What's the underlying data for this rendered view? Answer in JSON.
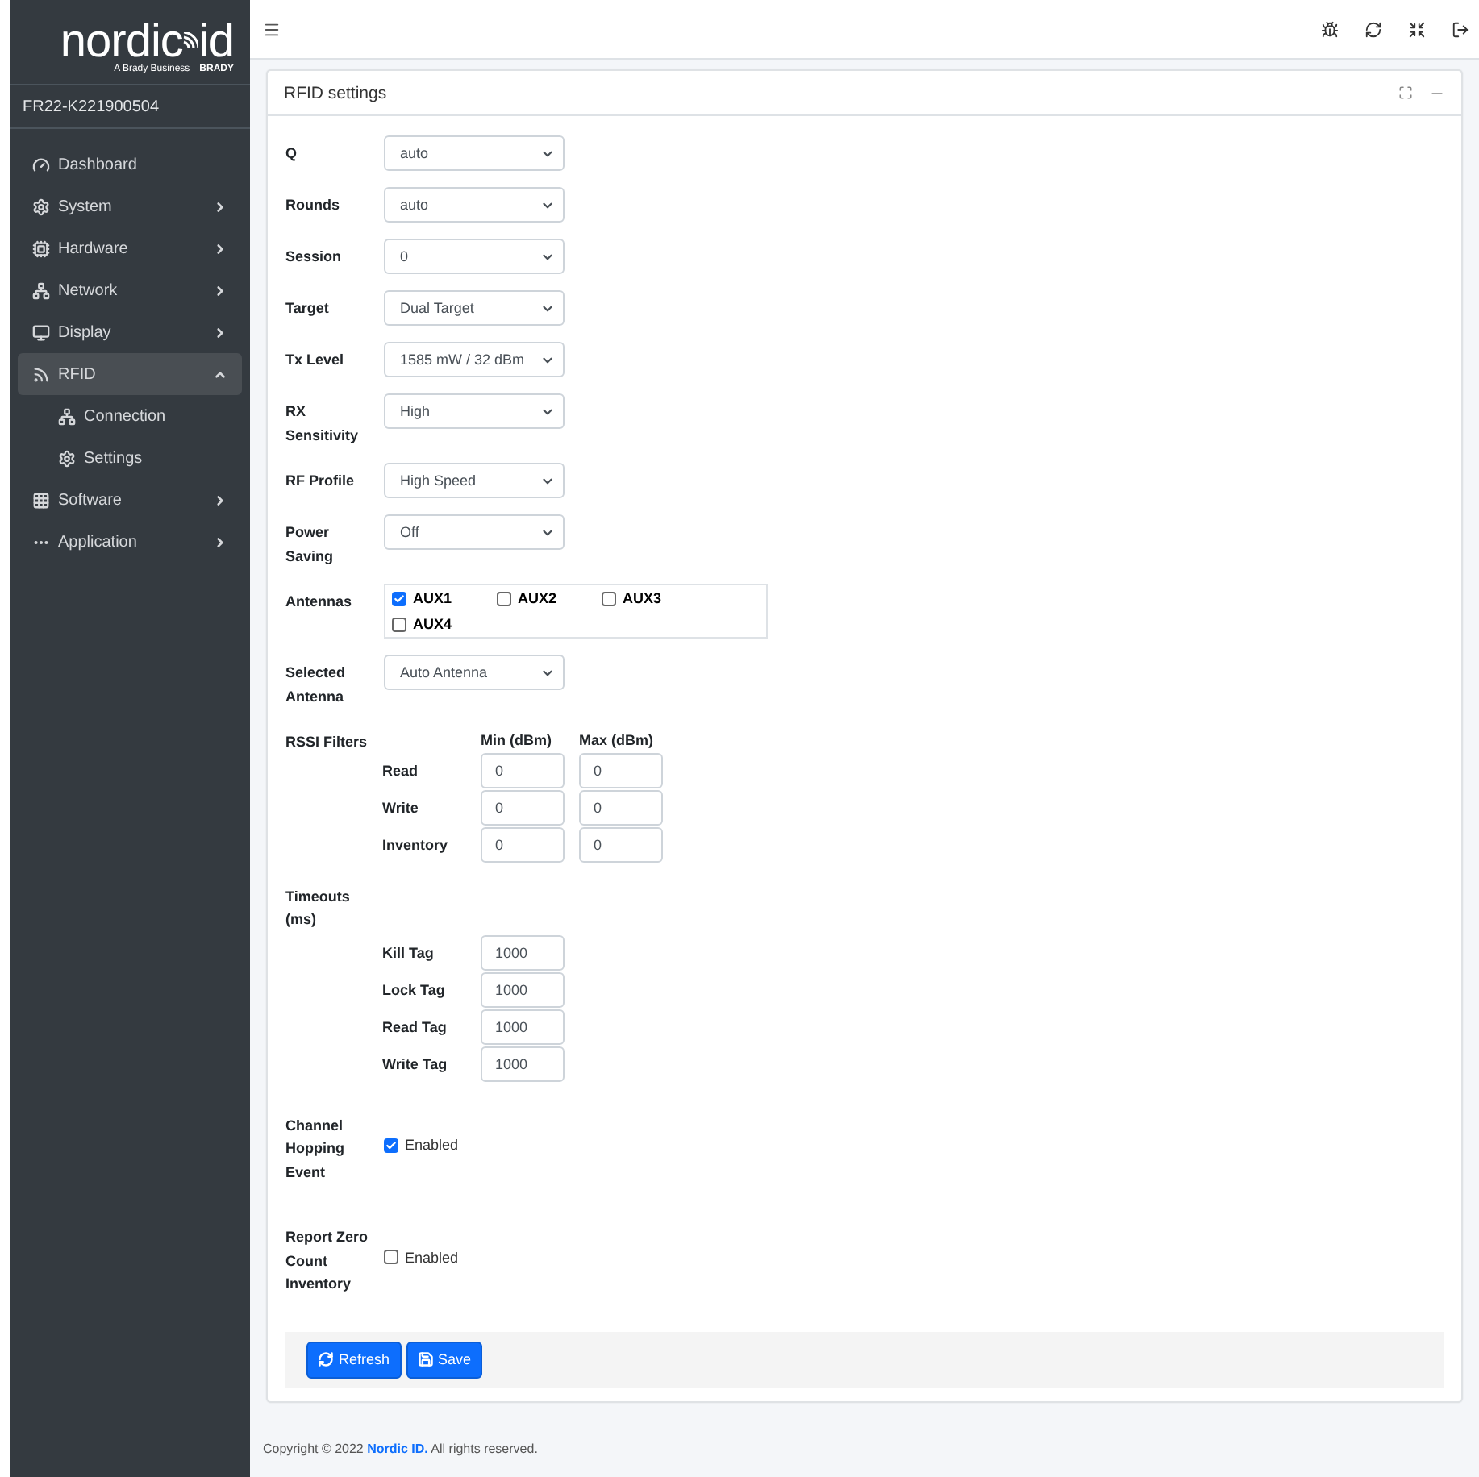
{
  "logo": {
    "name_left": "nordic",
    "name_right": "id",
    "tagline": "A Brady Business",
    "brand": "BRADY"
  },
  "device": "FR22-K221900504",
  "nav": [
    {
      "label": "Dashboard",
      "expandable": false,
      "expanded": false,
      "selected": false
    },
    {
      "label": "System",
      "expandable": true,
      "expanded": false,
      "selected": false
    },
    {
      "label": "Hardware",
      "expandable": true,
      "expanded": false,
      "selected": false
    },
    {
      "label": "Network",
      "expandable": true,
      "expanded": false,
      "selected": false
    },
    {
      "label": "Display",
      "expandable": true,
      "expanded": false,
      "selected": false
    },
    {
      "label": "RFID",
      "expandable": true,
      "expanded": true,
      "selected": true,
      "children": [
        {
          "label": "Connection"
        },
        {
          "label": "Settings"
        }
      ]
    },
    {
      "label": "Software",
      "expandable": true,
      "expanded": false,
      "selected": false
    },
    {
      "label": "Application",
      "expandable": true,
      "expanded": false,
      "selected": false
    }
  ],
  "card": {
    "title": "RFID settings"
  },
  "fields": [
    {
      "kind": "select",
      "label": "Q",
      "value": "auto"
    },
    {
      "kind": "select",
      "label": "Rounds",
      "value": "auto"
    },
    {
      "kind": "select",
      "label": "Session",
      "value": "0"
    },
    {
      "kind": "select",
      "label": "Target",
      "value": "Dual Target"
    },
    {
      "kind": "select",
      "label": "Tx Level",
      "value": "1585 mW / 32 dBm"
    },
    {
      "kind": "select",
      "label": "RX Sensitivity",
      "value": "High"
    },
    {
      "kind": "select",
      "label": "RF Profile",
      "value": "High Speed"
    },
    {
      "kind": "select",
      "label": "Power Saving",
      "value": "Off"
    },
    {
      "kind": "checkgroup",
      "label": "Antennas",
      "options": [
        {
          "label": "AUX1",
          "checked": true
        },
        {
          "label": "AUX2",
          "checked": false
        },
        {
          "label": "AUX3",
          "checked": false
        },
        {
          "label": "AUX4",
          "checked": false
        }
      ]
    },
    {
      "kind": "select",
      "label": "Selected Antenna",
      "value": "Auto Antenna"
    },
    {
      "kind": "pairs",
      "label": "RSSI Filters",
      "columns": [
        "Min (dBm)",
        "Max (dBm)"
      ],
      "rows": [
        {
          "label": "Read",
          "values": [
            "0",
            "0"
          ]
        },
        {
          "label": "Write",
          "values": [
            "0",
            "0"
          ]
        },
        {
          "label": "Inventory",
          "values": [
            "0",
            "0"
          ]
        }
      ]
    },
    {
      "kind": "pairs",
      "label": "Timeouts (ms)",
      "rows": [
        {
          "label": "Kill Tag",
          "values": [
            "1000"
          ]
        },
        {
          "label": "Lock Tag",
          "values": [
            "1000"
          ]
        },
        {
          "label": "Read Tag",
          "values": [
            "1000"
          ]
        },
        {
          "label": "Write Tag",
          "values": [
            "1000"
          ]
        }
      ]
    },
    {
      "kind": "checkbox",
      "label": "Channel Hopping Event",
      "option": "Enabled",
      "checked": true
    },
    {
      "kind": "checkbox",
      "label": "Report Zero Count Inventory",
      "option": "Enabled",
      "checked": false
    }
  ],
  "buttons": [
    {
      "label": "Refresh"
    },
    {
      "label": "Save"
    }
  ],
  "footer": {
    "prefix": "Copyright © 2022",
    "link": "Nordic ID.",
    "suffix": "All rights reserved."
  }
}
